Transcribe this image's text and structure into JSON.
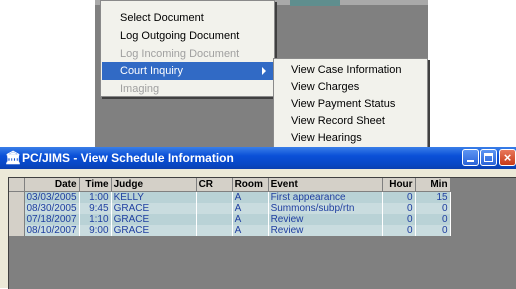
{
  "menu": {
    "items": [
      {
        "label": "Select Document",
        "state": "normal"
      },
      {
        "label": "Log Outgoing Document",
        "state": "normal"
      },
      {
        "label": "Log Incoming Document",
        "state": "disabled"
      },
      {
        "label": "Court Inquiry",
        "state": "active",
        "has_submenu": true
      },
      {
        "label": "Imaging",
        "state": "disabled"
      }
    ]
  },
  "submenu": {
    "items": [
      {
        "label": "View Case Information"
      },
      {
        "label": "View Charges"
      },
      {
        "label": "View Payment Status"
      },
      {
        "label": "View Record Sheet"
      },
      {
        "label": "View Hearings"
      }
    ]
  },
  "window": {
    "title": "PC/JIMS - View Schedule Information",
    "icon": "courthouse-icon",
    "controls": {
      "minimize": "minimize-icon",
      "maximize": "maximize-icon",
      "close": "close-icon"
    }
  },
  "table": {
    "columns": [
      "Date",
      "Time",
      "Judge",
      "CR",
      "Room",
      "Event",
      "Hour",
      "Min"
    ],
    "rows": [
      [
        "03/03/2005",
        "1:00",
        "KELLY",
        "",
        "A",
        "First appearance",
        "0",
        "15"
      ],
      [
        "08/30/2005",
        "9:45",
        "GRACE",
        "",
        "A",
        "Summons/subp/rtn",
        "0",
        "0"
      ],
      [
        "07/18/2007",
        "1:10",
        "GRACE",
        "",
        "A",
        "Review",
        "0",
        "0"
      ],
      [
        "08/10/2007",
        "9:00",
        "GRACE",
        "",
        "A",
        "Review",
        "0",
        "0"
      ]
    ]
  },
  "colors": {
    "titlebar": "#0a50d8",
    "row_bg": "#b9d2d6",
    "row_text": "#1f3fa0",
    "menu_highlight": "#316ac5"
  }
}
